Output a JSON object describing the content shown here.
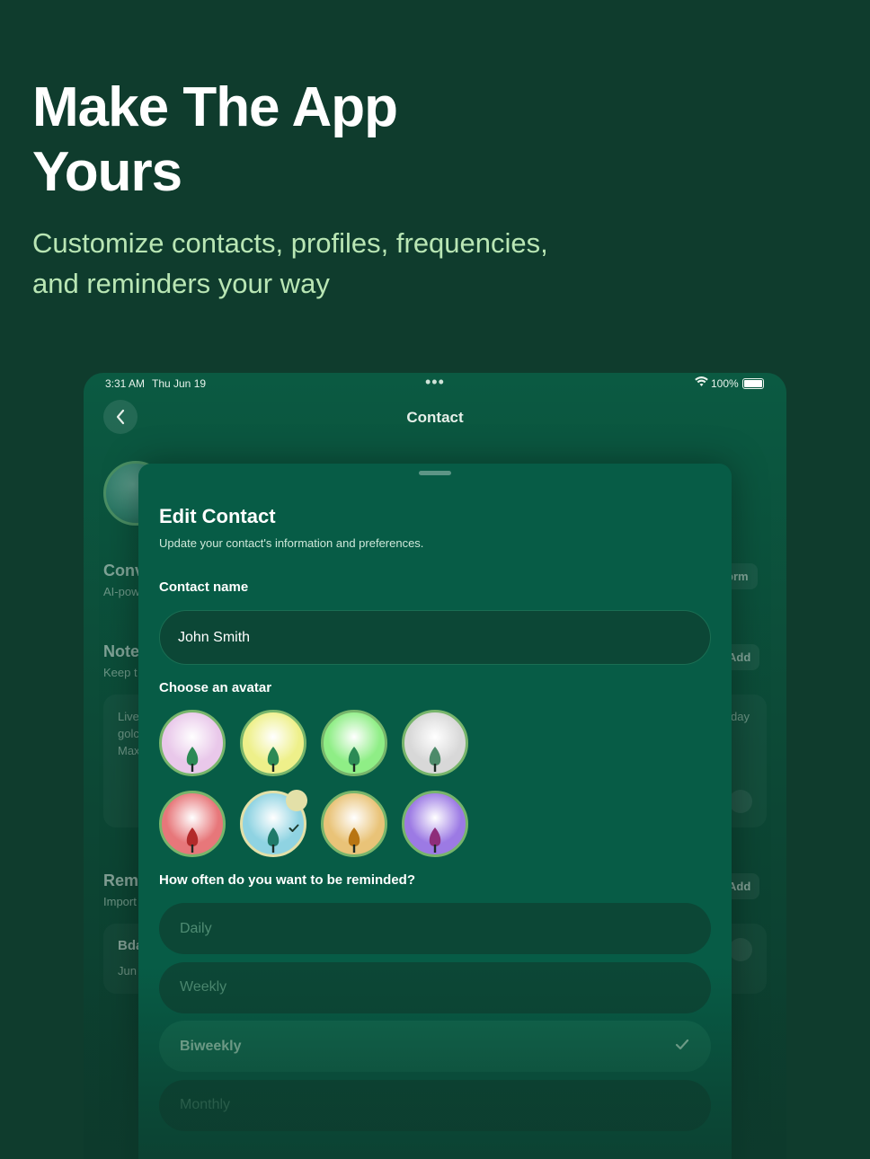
{
  "hero": {
    "title": "Make The App Yours",
    "subtitle": "Customize contacts, profiles, frequencies, and reminders your way"
  },
  "status_bar": {
    "time": "3:31 AM",
    "date": "Thu Jun 19",
    "battery": "100%"
  },
  "nav": {
    "title": "Contact"
  },
  "background": {
    "conv_label": "Conv",
    "conv_sub": "AI-pow",
    "form_btn": "orm",
    "notes_label": "Note",
    "notes_sub": "Keep t",
    "notes_add": "Add",
    "note_line1": "Live",
    "note_line2": "golc",
    "note_line3": "Max",
    "note_day": "day",
    "rem_label": "Rem",
    "rem_sub": "Import",
    "rem_add": "Add",
    "bday_label": "Bda",
    "bday_sub": "Jun"
  },
  "sheet": {
    "title": "Edit Contact",
    "subtitle": "Update your contact's information and preferences.",
    "name_label": "Contact name",
    "name_value": "John Smith",
    "avatar_label": "Choose an avatar",
    "avatars": [
      {
        "color": "#e9c8ea",
        "tree": "#2c8a55",
        "selected": false
      },
      {
        "color": "#eef08a",
        "tree": "#2c8a55",
        "selected": false
      },
      {
        "color": "#8fee86",
        "tree": "#2c8a55",
        "selected": false
      },
      {
        "color": "#d8d8d8",
        "tree": "#4d8a6a",
        "selected": false
      },
      {
        "color": "#e7777a",
        "tree": "#b22a2a",
        "selected": false
      },
      {
        "color": "#8fd3e2",
        "tree": "#1f7a6a",
        "selected": true
      },
      {
        "color": "#e9c378",
        "tree": "#b87512",
        "selected": false
      },
      {
        "color": "#9c7ae4",
        "tree": "#8e2d7a",
        "selected": false
      }
    ],
    "frequency_label": "How often do you want to be reminded?",
    "frequencies": [
      {
        "label": "Daily",
        "selected": false
      },
      {
        "label": "Weekly",
        "selected": false
      },
      {
        "label": "Biweekly",
        "selected": true
      },
      {
        "label": "Monthly",
        "selected": false
      }
    ]
  },
  "colors": {
    "background": "#0f3c2d",
    "sheet": "#075c46",
    "accent_green": "#b9e6b4",
    "selected_ring": "#e3e0a8"
  }
}
